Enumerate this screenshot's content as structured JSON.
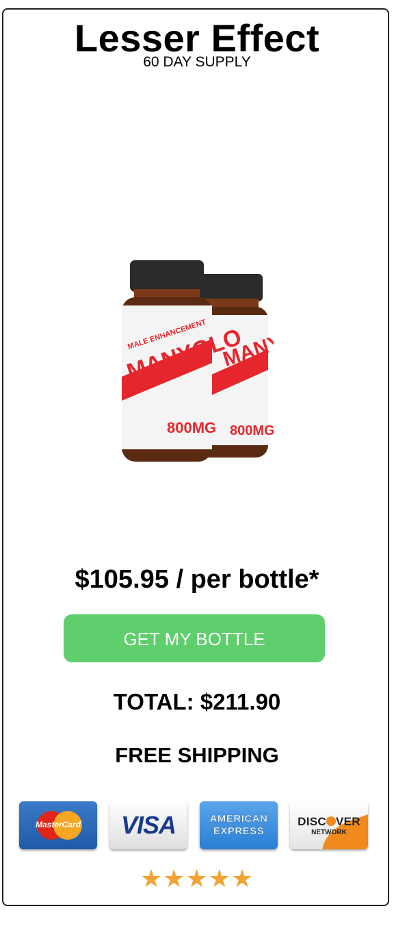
{
  "offer": {
    "title": "Lesser Effect",
    "supply": "60 DAY SUPPLY",
    "price": "$105.95 / per bottle*",
    "cta_label": "GET MY BOTTLE",
    "total": "TOTAL: $211.90",
    "shipping": "FREE SHIPPING"
  },
  "product": {
    "bottle_count": 2,
    "label_line1": "MALE ENHANCEMENT",
    "brand": "MANYOLO",
    "dose": "800MG",
    "colors": {
      "cap": "#2b2b2b",
      "label": "#f4f4f4",
      "accent": "#e5262d"
    }
  },
  "payments": {
    "mastercard": "MasterCard",
    "visa": "VISA",
    "amex_line1": "AMERICAN",
    "amex_line2": "EXPRESS",
    "discover_name": "DISC",
    "discover_tail": "VER",
    "discover_network": "NETWORK"
  },
  "rating": {
    "stars": "★★★★★",
    "value": 5,
    "max": 5
  },
  "colors": {
    "cta": "#5ecf6c",
    "star": "#f0a436",
    "border": "#222222"
  }
}
